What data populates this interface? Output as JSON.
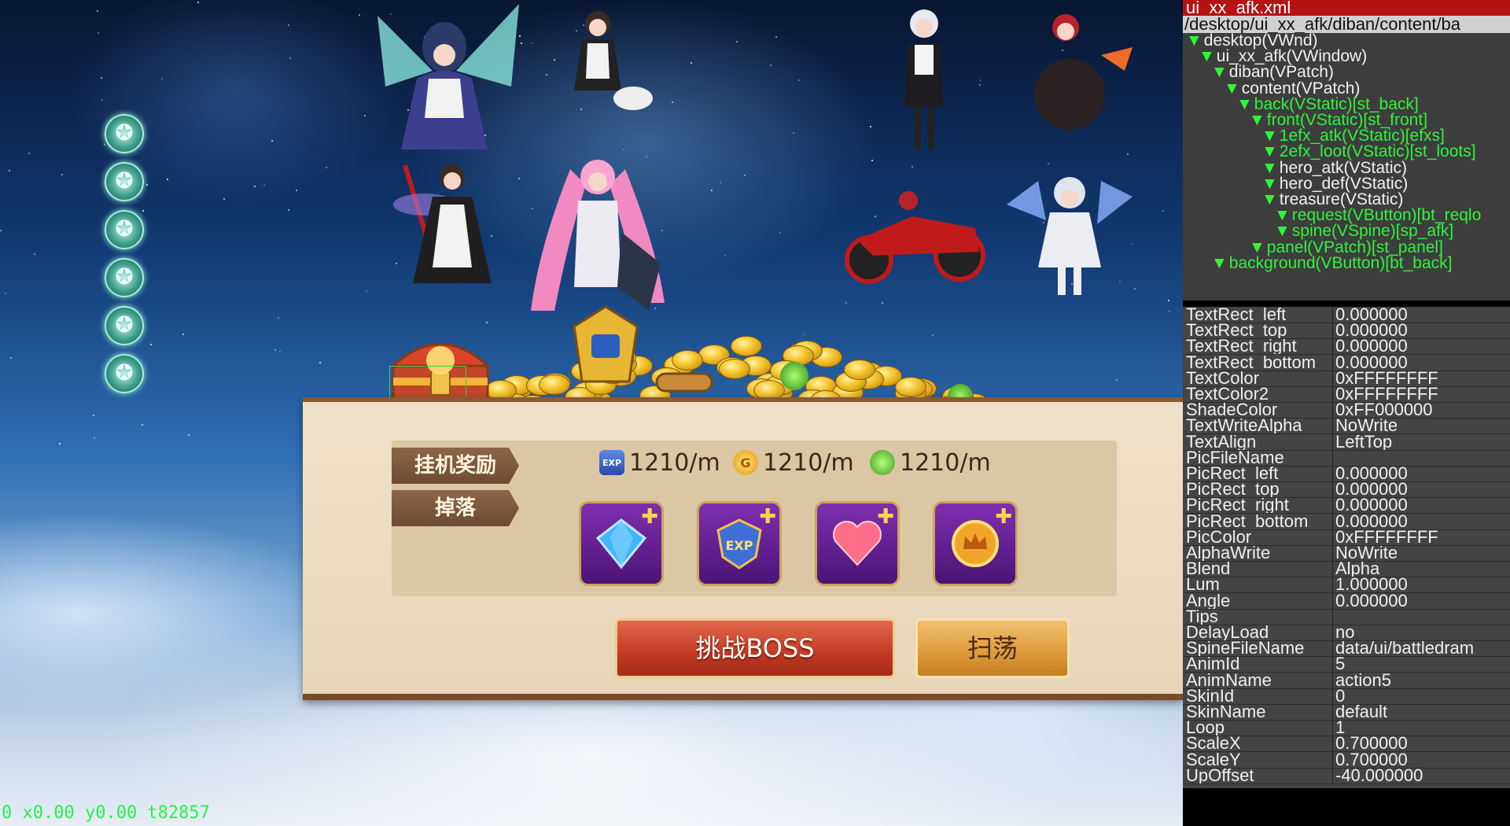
{
  "game": {
    "panel": {
      "idle_reward_label": "挂机奖励",
      "drop_label": "掉落",
      "rates": [
        {
          "icon": "exp-badge-icon",
          "text": "1210/m"
        },
        {
          "icon": "gold-coin-icon",
          "text": "1210/m"
        },
        {
          "icon": "green-potion-icon",
          "text": "1210/m"
        }
      ],
      "gold_icon_letter": "G",
      "exp_icon_text": "EXP",
      "drops": [
        {
          "icon": "blue-gem-icon"
        },
        {
          "icon": "exp-shield-icon",
          "text": "EXP"
        },
        {
          "icon": "heart-icon"
        },
        {
          "icon": "crown-coin-icon"
        }
      ],
      "challenge_boss_label": "挑战BOSS",
      "sweep_label": "扫荡"
    },
    "debug_status": "0  x0.00  y0.00  t82857",
    "colors": {
      "accent_green": "#2ef53a",
      "button_red": "#c03a22",
      "button_orange": "#dd9a3b"
    }
  },
  "inspector": {
    "title": "ui_xx_afk.xml",
    "path": "/desktop/ui_xx_afk/diban/content/ba",
    "tree": [
      {
        "label": "desktop(VWnd)",
        "depth": 0,
        "green": false
      },
      {
        "label": "ui_xx_afk(VWindow)",
        "depth": 1,
        "green": false
      },
      {
        "label": "diban(VPatch)",
        "depth": 2,
        "green": false
      },
      {
        "label": "content(VPatch)",
        "depth": 3,
        "green": false
      },
      {
        "label": "back(VStatic)[st_back]",
        "depth": 4,
        "green": true
      },
      {
        "label": "front(VStatic)[st_front]",
        "depth": 5,
        "green": true
      },
      {
        "label": "1efx_atk(VStatic)[efxs]",
        "depth": 6,
        "green": true
      },
      {
        "label": "2efx_loot(VStatic)[st_loots]",
        "depth": 6,
        "green": true
      },
      {
        "label": "hero_atk(VStatic)",
        "depth": 6,
        "green": false
      },
      {
        "label": "hero_def(VStatic)",
        "depth": 6,
        "green": false
      },
      {
        "label": "treasure(VStatic)",
        "depth": 6,
        "green": false
      },
      {
        "label": "request(VButton)[bt_reqlo",
        "depth": 7,
        "green": true
      },
      {
        "label": "spine(VSpine)[sp_afk]",
        "depth": 7,
        "green": true,
        "selected": true
      },
      {
        "label": "panel(VPatch)[st_panel]",
        "depth": 5,
        "green": true
      },
      {
        "label": "background(VButton)[bt_back]",
        "depth": 2,
        "green": true
      }
    ],
    "properties": [
      {
        "k": "TextRect_left",
        "v": "0.000000"
      },
      {
        "k": "TextRect_top",
        "v": "0.000000"
      },
      {
        "k": "TextRect_right",
        "v": "0.000000"
      },
      {
        "k": "TextRect_bottom",
        "v": "0.000000"
      },
      {
        "k": "TextColor",
        "v": "0xFFFFFFFF"
      },
      {
        "k": "TextColor2",
        "v": "0xFFFFFFFF"
      },
      {
        "k": "ShadeColor",
        "v": "0xFF000000"
      },
      {
        "k": "TextWriteAlpha",
        "v": "NoWrite"
      },
      {
        "k": "TextAlign",
        "v": "LeftTop"
      },
      {
        "k": "PicFileName",
        "v": ""
      },
      {
        "k": "PicRect_left",
        "v": "0.000000"
      },
      {
        "k": "PicRect_top",
        "v": "0.000000"
      },
      {
        "k": "PicRect_right",
        "v": "0.000000"
      },
      {
        "k": "PicRect_bottom",
        "v": "0.000000"
      },
      {
        "k": "PicColor",
        "v": "0xFFFFFFFF"
      },
      {
        "k": "AlphaWrite",
        "v": "NoWrite"
      },
      {
        "k": "Blend",
        "v": "Alpha"
      },
      {
        "k": "Lum",
        "v": "1.000000"
      },
      {
        "k": "Angle",
        "v": "0.000000"
      },
      {
        "k": "Tips",
        "v": ""
      },
      {
        "k": "DelayLoad",
        "v": "no"
      },
      {
        "k": "SpineFileName",
        "v": "data/ui/battledram"
      },
      {
        "k": "AnimId",
        "v": "5"
      },
      {
        "k": "AnimName",
        "v": "action5"
      },
      {
        "k": "SkinId",
        "v": "0"
      },
      {
        "k": "SkinName",
        "v": "default"
      },
      {
        "k": "Loop",
        "v": "1"
      },
      {
        "k": "ScaleX",
        "v": "0.700000"
      },
      {
        "k": "ScaleY",
        "v": "0.700000"
      },
      {
        "k": "UpOffset",
        "v": "-40.000000"
      }
    ]
  }
}
